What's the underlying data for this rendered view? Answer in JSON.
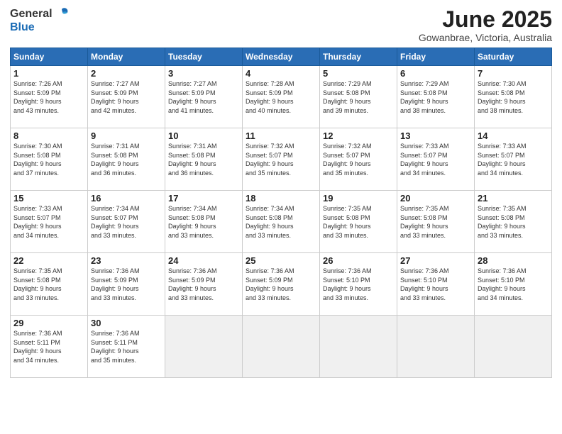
{
  "logo": {
    "general": "General",
    "blue": "Blue"
  },
  "title": "June 2025",
  "subtitle": "Gowanbrae, Victoria, Australia",
  "days_header": [
    "Sunday",
    "Monday",
    "Tuesday",
    "Wednesday",
    "Thursday",
    "Friday",
    "Saturday"
  ],
  "weeks": [
    [
      {
        "day": "1",
        "info": "Sunrise: 7:26 AM\nSunset: 5:09 PM\nDaylight: 9 hours\nand 43 minutes."
      },
      {
        "day": "2",
        "info": "Sunrise: 7:27 AM\nSunset: 5:09 PM\nDaylight: 9 hours\nand 42 minutes."
      },
      {
        "day": "3",
        "info": "Sunrise: 7:27 AM\nSunset: 5:09 PM\nDaylight: 9 hours\nand 41 minutes."
      },
      {
        "day": "4",
        "info": "Sunrise: 7:28 AM\nSunset: 5:09 PM\nDaylight: 9 hours\nand 40 minutes."
      },
      {
        "day": "5",
        "info": "Sunrise: 7:29 AM\nSunset: 5:08 PM\nDaylight: 9 hours\nand 39 minutes."
      },
      {
        "day": "6",
        "info": "Sunrise: 7:29 AM\nSunset: 5:08 PM\nDaylight: 9 hours\nand 38 minutes."
      },
      {
        "day": "7",
        "info": "Sunrise: 7:30 AM\nSunset: 5:08 PM\nDaylight: 9 hours\nand 38 minutes."
      }
    ],
    [
      {
        "day": "8",
        "info": "Sunrise: 7:30 AM\nSunset: 5:08 PM\nDaylight: 9 hours\nand 37 minutes."
      },
      {
        "day": "9",
        "info": "Sunrise: 7:31 AM\nSunset: 5:08 PM\nDaylight: 9 hours\nand 36 minutes."
      },
      {
        "day": "10",
        "info": "Sunrise: 7:31 AM\nSunset: 5:08 PM\nDaylight: 9 hours\nand 36 minutes."
      },
      {
        "day": "11",
        "info": "Sunrise: 7:32 AM\nSunset: 5:07 PM\nDaylight: 9 hours\nand 35 minutes."
      },
      {
        "day": "12",
        "info": "Sunrise: 7:32 AM\nSunset: 5:07 PM\nDaylight: 9 hours\nand 35 minutes."
      },
      {
        "day": "13",
        "info": "Sunrise: 7:33 AM\nSunset: 5:07 PM\nDaylight: 9 hours\nand 34 minutes."
      },
      {
        "day": "14",
        "info": "Sunrise: 7:33 AM\nSunset: 5:07 PM\nDaylight: 9 hours\nand 34 minutes."
      }
    ],
    [
      {
        "day": "15",
        "info": "Sunrise: 7:33 AM\nSunset: 5:07 PM\nDaylight: 9 hours\nand 34 minutes."
      },
      {
        "day": "16",
        "info": "Sunrise: 7:34 AM\nSunset: 5:07 PM\nDaylight: 9 hours\nand 33 minutes."
      },
      {
        "day": "17",
        "info": "Sunrise: 7:34 AM\nSunset: 5:08 PM\nDaylight: 9 hours\nand 33 minutes."
      },
      {
        "day": "18",
        "info": "Sunrise: 7:34 AM\nSunset: 5:08 PM\nDaylight: 9 hours\nand 33 minutes."
      },
      {
        "day": "19",
        "info": "Sunrise: 7:35 AM\nSunset: 5:08 PM\nDaylight: 9 hours\nand 33 minutes."
      },
      {
        "day": "20",
        "info": "Sunrise: 7:35 AM\nSunset: 5:08 PM\nDaylight: 9 hours\nand 33 minutes."
      },
      {
        "day": "21",
        "info": "Sunrise: 7:35 AM\nSunset: 5:08 PM\nDaylight: 9 hours\nand 33 minutes."
      }
    ],
    [
      {
        "day": "22",
        "info": "Sunrise: 7:35 AM\nSunset: 5:08 PM\nDaylight: 9 hours\nand 33 minutes."
      },
      {
        "day": "23",
        "info": "Sunrise: 7:36 AM\nSunset: 5:09 PM\nDaylight: 9 hours\nand 33 minutes."
      },
      {
        "day": "24",
        "info": "Sunrise: 7:36 AM\nSunset: 5:09 PM\nDaylight: 9 hours\nand 33 minutes."
      },
      {
        "day": "25",
        "info": "Sunrise: 7:36 AM\nSunset: 5:09 PM\nDaylight: 9 hours\nand 33 minutes."
      },
      {
        "day": "26",
        "info": "Sunrise: 7:36 AM\nSunset: 5:10 PM\nDaylight: 9 hours\nand 33 minutes."
      },
      {
        "day": "27",
        "info": "Sunrise: 7:36 AM\nSunset: 5:10 PM\nDaylight: 9 hours\nand 33 minutes."
      },
      {
        "day": "28",
        "info": "Sunrise: 7:36 AM\nSunset: 5:10 PM\nDaylight: 9 hours\nand 34 minutes."
      }
    ],
    [
      {
        "day": "29",
        "info": "Sunrise: 7:36 AM\nSunset: 5:11 PM\nDaylight: 9 hours\nand 34 minutes."
      },
      {
        "day": "30",
        "info": "Sunrise: 7:36 AM\nSunset: 5:11 PM\nDaylight: 9 hours\nand 35 minutes."
      },
      {
        "day": "",
        "info": ""
      },
      {
        "day": "",
        "info": ""
      },
      {
        "day": "",
        "info": ""
      },
      {
        "day": "",
        "info": ""
      },
      {
        "day": "",
        "info": ""
      }
    ]
  ]
}
